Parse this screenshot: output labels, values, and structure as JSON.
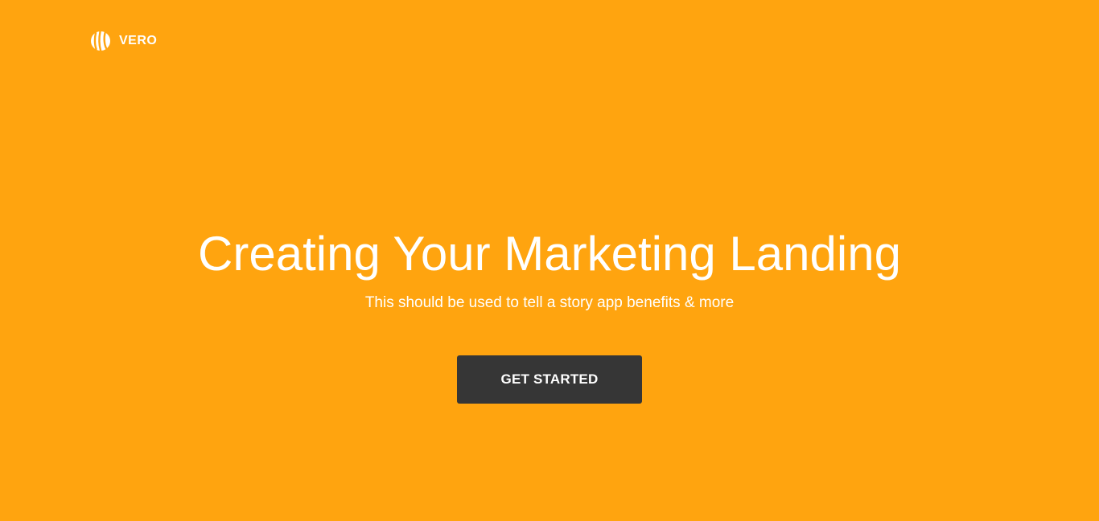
{
  "brand": {
    "name": "VERO",
    "icon": "vero-logo-icon"
  },
  "hero": {
    "title": "Creating Your Marketing Landing",
    "subtitle": "This should be used to tell a story app benefits & more",
    "cta_label": "GET STARTED"
  },
  "colors": {
    "background": "#FFA40F",
    "button": "#363636",
    "text": "#FFFFFF"
  }
}
